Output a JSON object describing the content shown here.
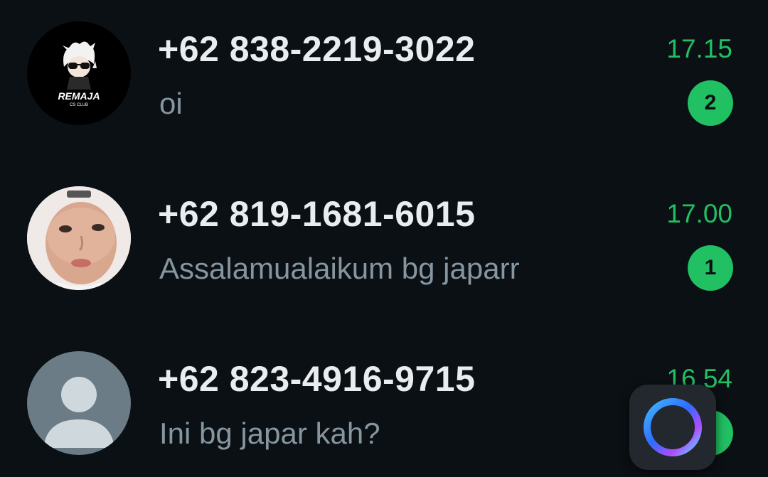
{
  "chats": [
    {
      "name": "+62 838-2219-3022",
      "preview": "oi",
      "time": "17.15",
      "unread": "2",
      "avatar_icon": "anime-character-logo-avatar",
      "avatar_text": "REMAJA",
      "avatar_subtext": "CS CLUB"
    },
    {
      "name": "+62 819-1681-6015",
      "preview": "Assalamualaikum bg japarr",
      "time": "17.00",
      "unread": "1",
      "avatar_icon": "selfie-photo-avatar"
    },
    {
      "name": "+62 823-4916-9715",
      "preview": "Ini bg japar kah?",
      "time": "16.54",
      "avatar_icon": "default-person-avatar"
    }
  ],
  "colors": {
    "background": "#0b1014",
    "name_text": "#e9edef",
    "preview_text": "#8696a0",
    "accent_green": "#21c063"
  },
  "floating_bubble_icon": "assistant-ring-icon"
}
